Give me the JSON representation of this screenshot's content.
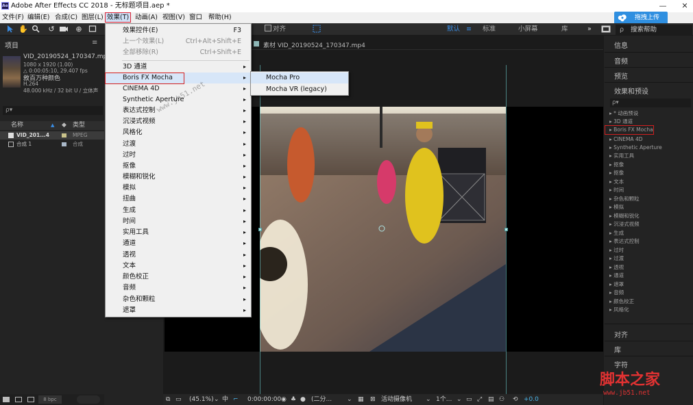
{
  "window": {
    "title": "Adobe After Effects CC 2018 - 无标题项目.aep *",
    "app_icon_label": "Ae",
    "minimize": "—",
    "close": "✕"
  },
  "upload_button": {
    "label": "拖拽上传"
  },
  "menubar": {
    "items": [
      "文件(F)",
      "编辑(E)",
      "合成(C)",
      "图层(L)",
      "效果(T)",
      "动画(A)",
      "视图(V)",
      "窗口",
      "帮助(H)"
    ],
    "active": "效果(T)"
  },
  "toolbar": {
    "align_label": "对齐",
    "workspaces": [
      "默认",
      "标准",
      "小屏幕",
      "库"
    ],
    "active_workspace": "默认",
    "more": "»",
    "search_help": "搜索帮助"
  },
  "project_panel": {
    "tab_label": "项目",
    "file_name": "VID_20190524_170347.mp4",
    "file_dims": "1080 x 1920 (1.00)",
    "file_duration": "△ 0:00:05:10, 29.407 fps",
    "file_title": "敘百万种颜色",
    "file_codec": "H.264",
    "file_audio": "48.000 kHz / 32 bit U / 立体声",
    "search_placeholder": "ρ▾",
    "col_name": "名称",
    "col_type": "类型",
    "rows": [
      {
        "name": "VID_201...4",
        "type": "MPEG"
      },
      {
        "name": "合成 1",
        "type": "合成"
      }
    ],
    "bpc": "8 bpc"
  },
  "effects_menu": {
    "items": [
      {
        "label": "效果控件(E)",
        "shortcut": "F3",
        "disabled": false
      },
      {
        "label": "上一个效果(L)",
        "shortcut": "Ctrl+Alt+Shift+E",
        "disabled": true
      },
      {
        "label": "全部移除(R)",
        "shortcut": "Ctrl+Shift+E",
        "disabled": true
      },
      {
        "label": "3D 通道",
        "submenu": true
      },
      {
        "label": "Boris FX Mocha",
        "submenu": true,
        "highlighted": true
      },
      {
        "label": "CINEMA 4D",
        "submenu": true
      },
      {
        "label": "Synthetic Aperture",
        "submenu": true
      },
      {
        "label": "表达式控制",
        "submenu": true
      },
      {
        "label": "沉浸式视频",
        "submenu": true
      },
      {
        "label": "风格化",
        "submenu": true
      },
      {
        "label": "过渡",
        "submenu": true
      },
      {
        "label": "过时",
        "submenu": true
      },
      {
        "label": "抠像",
        "submenu": true
      },
      {
        "label": "模糊和锐化",
        "submenu": true
      },
      {
        "label": "模拟",
        "submenu": true
      },
      {
        "label": "扭曲",
        "submenu": true
      },
      {
        "label": "生成",
        "submenu": true
      },
      {
        "label": "时间",
        "submenu": true
      },
      {
        "label": "实用工具",
        "submenu": true
      },
      {
        "label": "通道",
        "submenu": true
      },
      {
        "label": "透视",
        "submenu": true
      },
      {
        "label": "文本",
        "submenu": true
      },
      {
        "label": "颜色校正",
        "submenu": true
      },
      {
        "label": "音频",
        "submenu": true
      },
      {
        "label": "杂色和颗粒",
        "submenu": true
      },
      {
        "label": "遮罩",
        "submenu": true
      }
    ],
    "arrow": "▸"
  },
  "submenu": {
    "items": [
      "Mocha Pro",
      "Mocha VR (legacy)"
    ],
    "highlighted": "Mocha Pro"
  },
  "watermark_overlay": "www.jb51.net",
  "viewer": {
    "tab_label": "素材 VID_20190524_170347.mp4",
    "zoom": "(45.1%)",
    "timecode": "0:00:00:00",
    "resolution": "(二分...",
    "camera": "活动摄像机",
    "views": "1个...",
    "offset": "+0.0"
  },
  "right_panel": {
    "sections_top": [
      "信息",
      "音频",
      "预览",
      "效果和预设"
    ],
    "search_placeholder": "ρ▾",
    "effects": [
      "* 动画预设",
      "3D 通道",
      "Boris FX Mocha",
      "CINEMA 4D",
      "Synthetic Aperture",
      "实用工具",
      "抠像",
      "抠像",
      "文本",
      "时间",
      "杂色和颗粒",
      "模拟",
      "模糊和锐化",
      "沉浸式视频",
      "生成",
      "表达式控制",
      "过时",
      "过渡",
      "透视",
      "通道",
      "遮罩",
      "音频",
      "颜色校正",
      "风格化"
    ],
    "boxed_effect": "Boris FX Mocha",
    "sections_bottom": [
      "对齐",
      "库",
      "字符"
    ]
  },
  "watermark": {
    "brand": "脚本之家",
    "url": "www.jb51.net"
  },
  "colors": {
    "highlight_border": "#d21f1f",
    "menu_bg": "#f0f0f0",
    "panel_bg": "#232323",
    "accent_blue": "#3a8ee6",
    "bounds_cyan": "#6cc8c8"
  }
}
